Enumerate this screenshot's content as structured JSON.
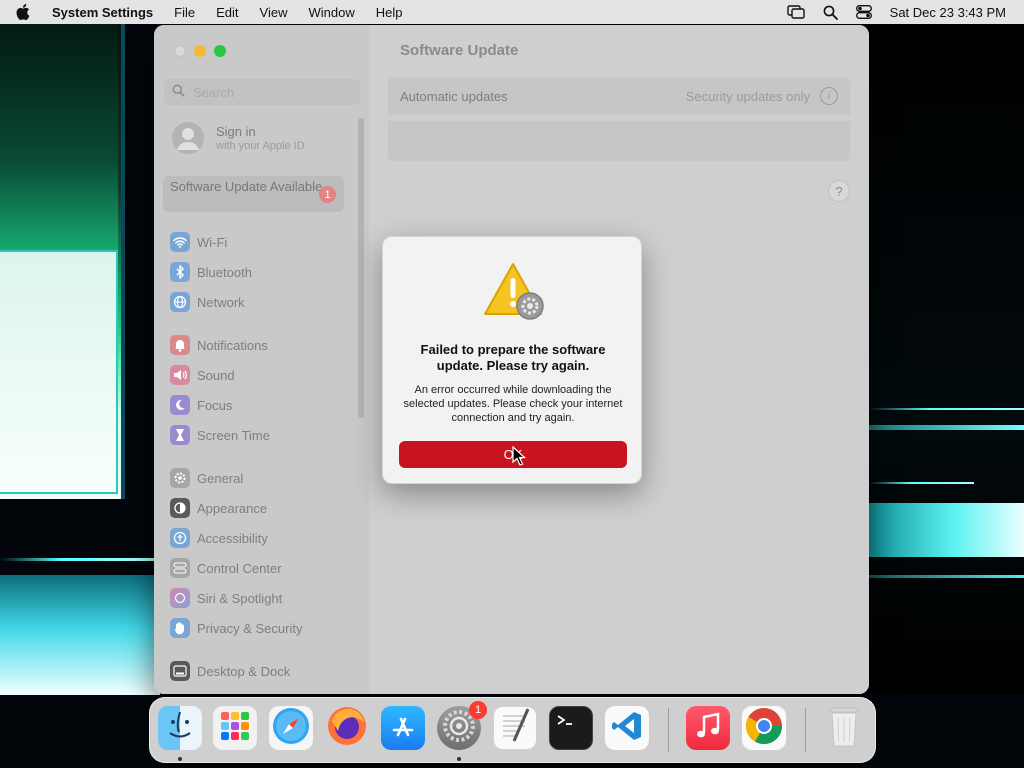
{
  "menubar": {
    "app_name": "System Settings",
    "menus": [
      "File",
      "Edit",
      "View",
      "Window",
      "Help"
    ],
    "clock": "Sat Dec 23  3:43 PM",
    "status_icons": [
      "screen-mirroring-icon",
      "spotlight-search-icon",
      "control-center-icon"
    ]
  },
  "window": {
    "title": "Software Update",
    "sidebar": {
      "search_placeholder": "Search",
      "signin": {
        "title": "Sign in",
        "subtitle": "with your Apple ID"
      },
      "update_available": {
        "label": "Software Update Available",
        "badge": "1"
      },
      "items": [
        {
          "label": "Wi-Fi",
          "icon": "wifi-icon",
          "color": "#7aa6d6"
        },
        {
          "label": "Bluetooth",
          "icon": "bluetooth-icon",
          "color": "#7aa6d6"
        },
        {
          "label": "Network",
          "icon": "network-globe-icon",
          "color": "#7aa6d6"
        },
        {
          "label": "Notifications",
          "icon": "notifications-bell-icon",
          "color": "#d98a8a"
        },
        {
          "label": "Sound",
          "icon": "sound-speaker-icon",
          "color": "#d98a9e"
        },
        {
          "label": "Focus",
          "icon": "focus-moon-icon",
          "color": "#9a8ad0"
        },
        {
          "label": "Screen Time",
          "icon": "screen-time-hourglass-icon",
          "color": "#9a8ad0"
        },
        {
          "label": "General",
          "icon": "general-gear-icon",
          "color": "#a6a6a6"
        },
        {
          "label": "Appearance",
          "icon": "appearance-icon",
          "color": "#5a5a5a"
        },
        {
          "label": "Accessibility",
          "icon": "accessibility-icon",
          "color": "#7aa6d6"
        },
        {
          "label": "Control Center",
          "icon": "control-center-icon",
          "color": "#a6a6a6"
        },
        {
          "label": "Siri & Spotlight",
          "icon": "siri-icon",
          "color": "#b08ad0"
        },
        {
          "label": "Privacy & Security",
          "icon": "privacy-hand-icon",
          "color": "#7aa6d6"
        },
        {
          "label": "Desktop & Dock",
          "icon": "desktop-dock-icon",
          "color": "#5a5a5a"
        }
      ]
    },
    "content": {
      "automatic_updates_label": "Automatic updates",
      "automatic_updates_value": "Security updates only",
      "help_label": "?"
    }
  },
  "alert": {
    "title": "Failed to prepare the software update. Please try again.",
    "message": "An error occurred while downloading the selected updates. Please check your internet connection and try again.",
    "ok_label": "OK"
  },
  "dock": {
    "apps": [
      {
        "name": "Finder",
        "icon": "finder-icon",
        "running": true
      },
      {
        "name": "Launchpad",
        "icon": "launchpad-icon",
        "running": false
      },
      {
        "name": "Safari",
        "icon": "safari-icon",
        "running": false
      },
      {
        "name": "Firefox",
        "icon": "firefox-icon",
        "running": false
      },
      {
        "name": "App Store",
        "icon": "app-store-icon",
        "running": false
      },
      {
        "name": "System Settings",
        "icon": "system-settings-icon",
        "running": true,
        "badge": "1"
      },
      {
        "name": "TextEdit",
        "icon": "textedit-icon",
        "running": false
      },
      {
        "name": "Terminal",
        "icon": "terminal-icon",
        "running": false
      },
      {
        "name": "Visual Studio Code",
        "icon": "vscode-icon",
        "running": false
      },
      {
        "name": "Music",
        "icon": "music-icon",
        "running": false
      },
      {
        "name": "Google Chrome",
        "icon": "chrome-icon",
        "running": false
      },
      {
        "name": "Trash",
        "icon": "trash-icon",
        "running": false
      }
    ]
  }
}
